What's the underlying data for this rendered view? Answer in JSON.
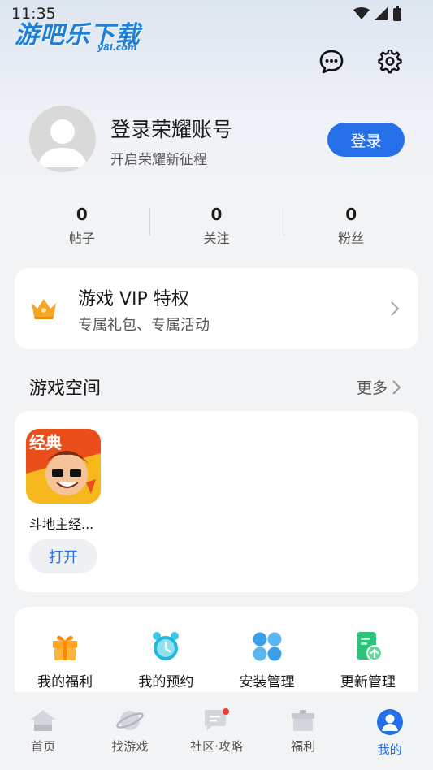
{
  "status": {
    "time": "11:35"
  },
  "watermark": {
    "main": "游吧乐下载",
    "sub": "y8l.com"
  },
  "header": {
    "message_icon": "message-icon",
    "settings_icon": "gear-icon"
  },
  "profile": {
    "title": "登录荣耀账号",
    "subtitle": "开启荣耀新征程",
    "login_label": "登录"
  },
  "stats": [
    {
      "value": "0",
      "label": "帖子"
    },
    {
      "value": "0",
      "label": "关注"
    },
    {
      "value": "0",
      "label": "粉丝"
    }
  ],
  "vip": {
    "title": "游戏 VIP 特权",
    "subtitle": "专属礼包、专属活动"
  },
  "game_space": {
    "title": "游戏空间",
    "more": "更多"
  },
  "games": [
    {
      "name": "斗地主经...",
      "badge": "经典",
      "action": "打开"
    }
  ],
  "tools": [
    {
      "label": "我的福利",
      "icon": "gift-icon"
    },
    {
      "label": "我的预约",
      "icon": "alarm-clock-icon"
    },
    {
      "label": "安装管理",
      "icon": "apps-grid-icon"
    },
    {
      "label": "更新管理",
      "icon": "update-file-icon"
    }
  ],
  "nav": [
    {
      "label": "首页",
      "icon": "home-icon"
    },
    {
      "label": "找游戏",
      "icon": "planet-icon"
    },
    {
      "label": "社区·攻略",
      "icon": "chat-bubble-icon"
    },
    {
      "label": "福利",
      "icon": "gift-box-icon"
    },
    {
      "label": "我的",
      "icon": "user-icon",
      "active": true
    }
  ],
  "colors": {
    "accent": "#256fe8",
    "background": "#f1f3f5"
  }
}
